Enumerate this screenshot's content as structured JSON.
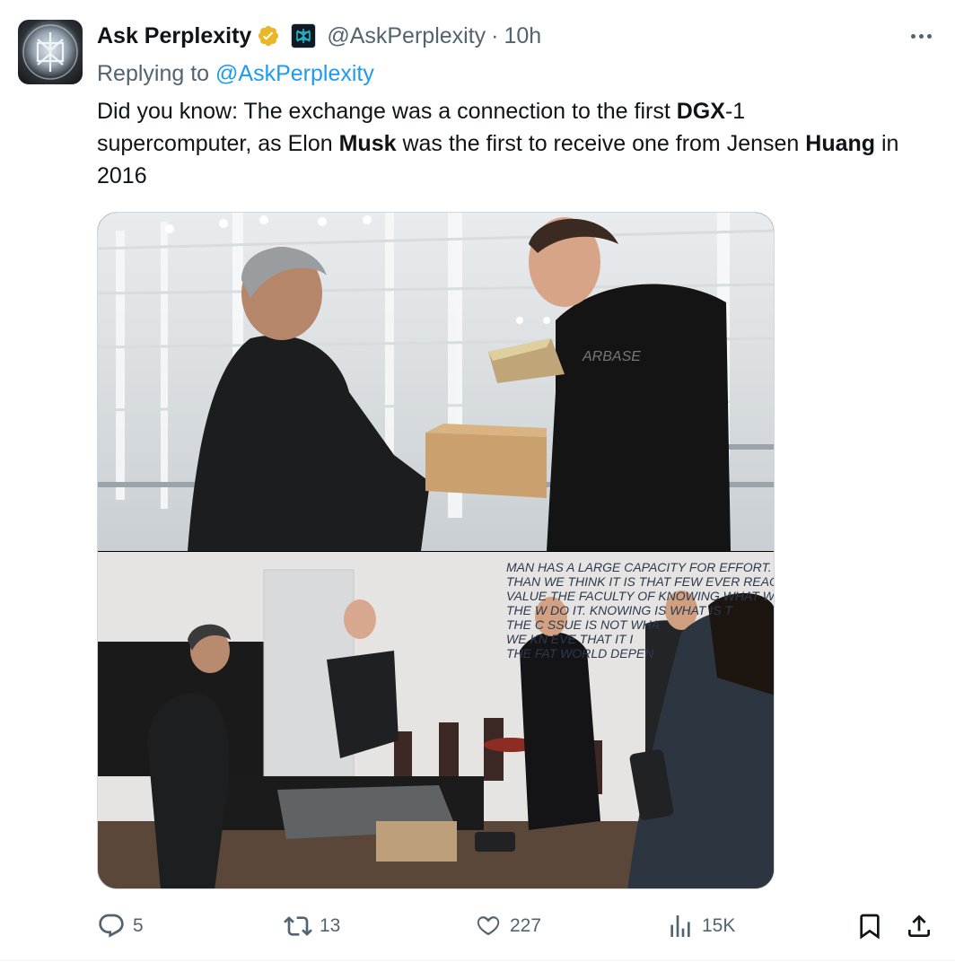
{
  "tweet": {
    "author_name": "Ask Perplexity",
    "handle": "@AskPerplexity",
    "separator": "·",
    "time": "10h",
    "replying_prefix": "Replying to",
    "replying_to": "@AskPerplexity",
    "text_parts": {
      "p1": "Did you know: The exchange was a connection to the first ",
      "b1": "DGX",
      "p2": "-1 supercomputer, as Elon ",
      "b2": "Musk",
      "p3": " was the first to receive one from Jensen ",
      "b3": "Huang",
      "p4": " in 2016"
    },
    "media": {
      "top_photo_shirt_text": "ARBASE",
      "wall_quote": [
        "MAN HAS A LARGE CAPACITY FOR EFFORT. IT",
        "THAN WE THINK IT IS THAT FEW EVER REACH",
        "VALUE THE FACULTY OF KNOWING WHAT WE",
        "THE W DO IT. KNOWING IS WHAT IS T",
        "THE C SSUE IS NOT WHA",
        "WE KN EVE THAT IT I",
        "THE FAT WORLD DEPEN"
      ]
    }
  },
  "actions": {
    "replies": "5",
    "reposts": "13",
    "likes": "227",
    "views": "15K"
  },
  "icons": {
    "verified": "verified-badge-icon",
    "affiliate": "perplexity-logo-icon",
    "more": "more-icon",
    "reply": "reply-icon",
    "repost": "repost-icon",
    "like": "heart-icon",
    "views": "views-icon",
    "bookmark": "bookmark-icon",
    "share": "share-icon"
  },
  "colors": {
    "accent": "#1d9bf0",
    "secondary_text": "#536471",
    "verified_gold": "#e8b829"
  }
}
